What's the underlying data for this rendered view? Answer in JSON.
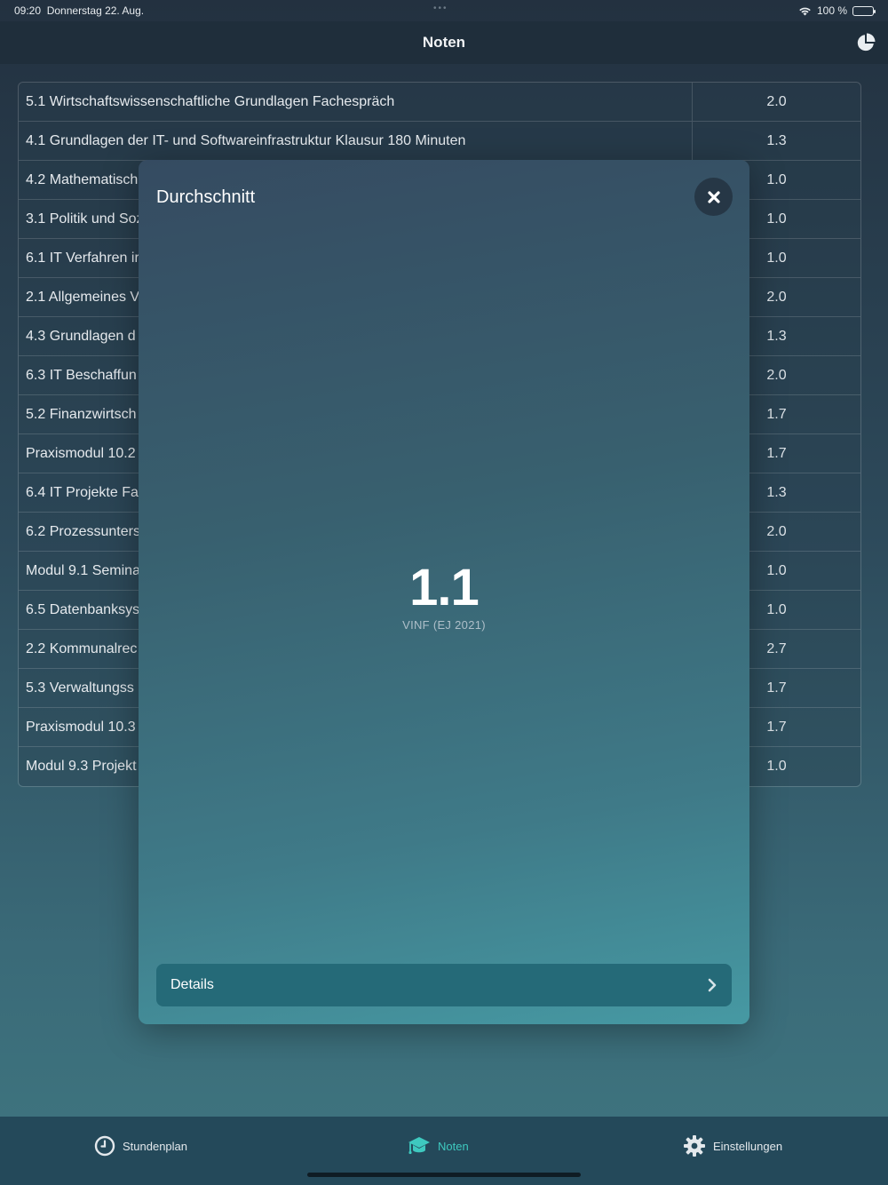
{
  "status_bar": {
    "time": "09:20",
    "date": "Donnerstag 22. Aug.",
    "battery": "100 %"
  },
  "nav": {
    "title": "Noten",
    "chart_icon": "pie-chart-icon"
  },
  "grades": [
    {
      "name": "5.1 Wirtschaftswissenschaftliche Grundlagen Fachespräch",
      "grade": "2.0"
    },
    {
      "name": "4.1 Grundlagen der IT- und Softwareinfrastruktur Klausur 180 Minuten",
      "grade": "1.3"
    },
    {
      "name": "4.2 Mathematisch",
      "grade": "1.0"
    },
    {
      "name": "3.1 Politik und Soz",
      "grade": "1.0"
    },
    {
      "name": "6.1 IT Verfahren ir",
      "grade": "1.0"
    },
    {
      "name": "2.1 Allgemeines V",
      "grade": "2.0"
    },
    {
      "name": "4.3 Grundlagen d",
      "grade": "1.3"
    },
    {
      "name": "6.3 IT Beschaffun",
      "grade": "2.0"
    },
    {
      "name": "5.2 Finanzwirtsch",
      "grade": "1.7"
    },
    {
      "name": "Praxismodul 10.2",
      "grade": "1.7"
    },
    {
      "name": "6.4 IT Projekte Fa",
      "grade": "1.3"
    },
    {
      "name": "6.2 Prozessunters",
      "grade": "2.0"
    },
    {
      "name": "Modul 9.1 Semina",
      "grade": "1.0"
    },
    {
      "name": "6.5 Datenbanksys",
      "grade": "1.0"
    },
    {
      "name": "2.2 Kommunalrec",
      "grade": "2.7"
    },
    {
      "name": "5.3 Verwaltungss",
      "grade": "1.7"
    },
    {
      "name": "Praxismodul 10.3",
      "grade": "1.7"
    },
    {
      "name": "Modul 9.3 Projekt",
      "grade": "1.0"
    }
  ],
  "modal": {
    "title": "Durchschnitt",
    "average": "1.1",
    "course": "VINF (EJ 2021)",
    "details_label": "Details"
  },
  "tabs": [
    {
      "label": "Stundenplan",
      "icon": "clock-icon"
    },
    {
      "label": "Noten",
      "icon": "graduation-cap-icon"
    },
    {
      "label": "Einstellungen",
      "icon": "gear-icon"
    }
  ],
  "colors": {
    "accent": "#3ec9bf",
    "tabbar": "#24495a",
    "details_button": "#256a78"
  }
}
